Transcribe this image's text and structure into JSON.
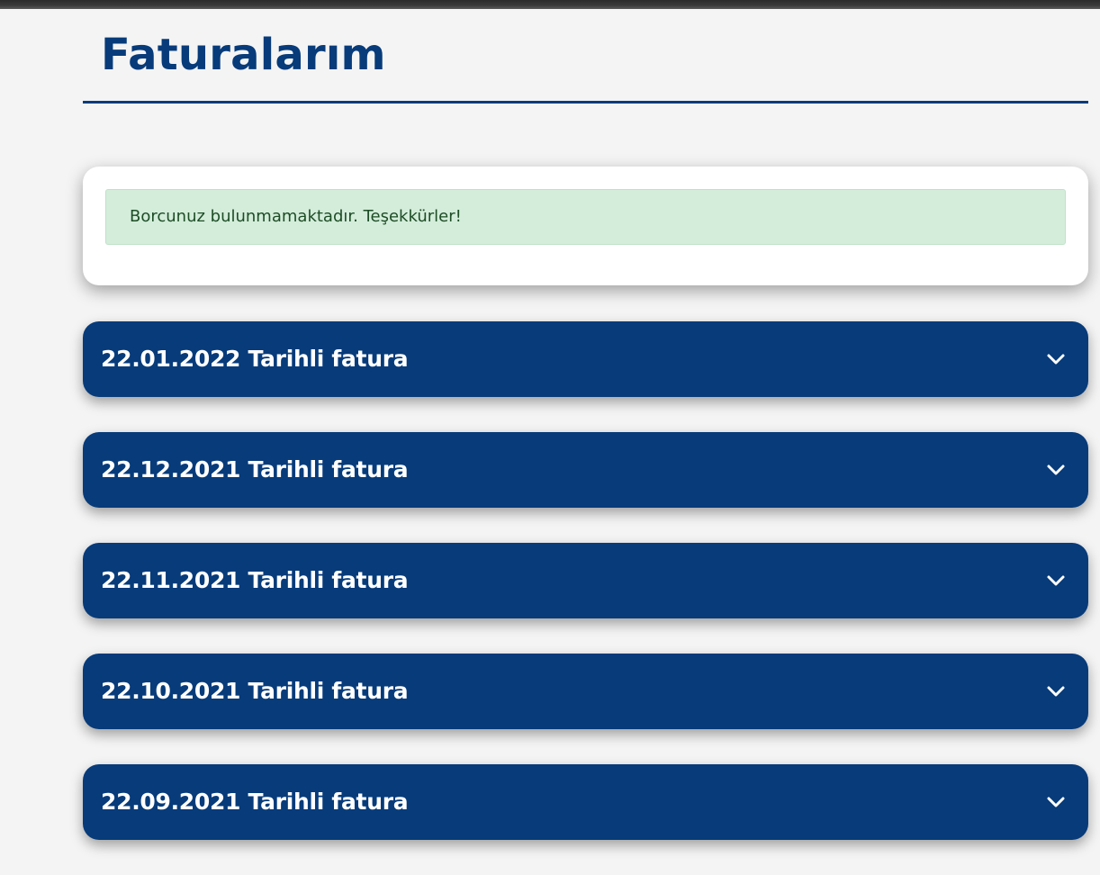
{
  "page": {
    "title": "Faturalarım"
  },
  "notice": {
    "message": "Borcunuz bulunmamaktadır. Teşekkürler!"
  },
  "invoices": [
    {
      "label": "22.01.2022 Tarihli fatura",
      "icon": "chevron-down-icon"
    },
    {
      "label": "22.12.2021 Tarihli fatura",
      "icon": "chevron-down-icon"
    },
    {
      "label": "22.11.2021 Tarihli fatura",
      "icon": "chevron-down-icon"
    },
    {
      "label": "22.10.2021 Tarihli fatura",
      "icon": "chevron-down-icon"
    },
    {
      "label": "22.09.2021 Tarihli fatura",
      "icon": "chevron-down-icon"
    }
  ],
  "colors": {
    "brand": "#073b7a",
    "alert_bg": "#d4eddb",
    "alert_text": "#1d4d25",
    "page_bg": "#f4f4f4"
  }
}
